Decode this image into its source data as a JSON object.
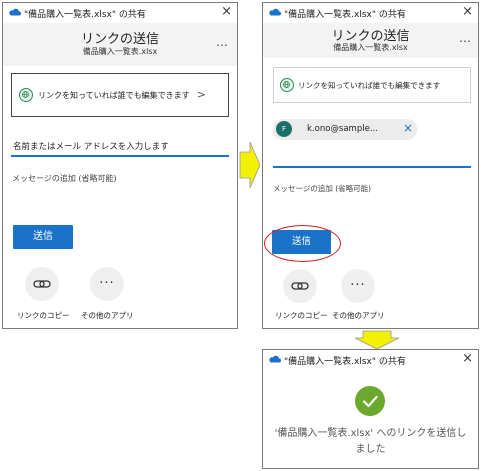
{
  "colors": {
    "accent": "#1a73c8",
    "success": "#6aa82e",
    "arrow": "#f2f200",
    "highlight": "#d02020"
  },
  "window_title": "\"備品購入一覧表.xlsx\" の共有",
  "close_icon": "×",
  "header": {
    "title": "リンクの送信",
    "subtitle": "備品購入一覧表.xlsx",
    "more": "…"
  },
  "link_setting": {
    "icon": "globe-icon",
    "label": "リンクを知っていれば誰でも編集できます",
    "chevron": ">"
  },
  "recipient": {
    "placeholder": "名前またはメール アドレスを入力します",
    "chip": {
      "initial": "F",
      "email": "k.ono@sample...",
      "remove": "×"
    }
  },
  "message_placeholder": "メッセージの追加 (省略可能)",
  "send_button": "送信",
  "actions": [
    {
      "label": "リンクのコピー",
      "icon": "link-icon"
    },
    {
      "label": "その他のアプリ",
      "icon": "more-apps-icon",
      "glyph": "···"
    }
  ],
  "confirmation": {
    "line1": "'備品購入一覧表.xlsx' へのリンクを送信し",
    "line2": "ました"
  }
}
